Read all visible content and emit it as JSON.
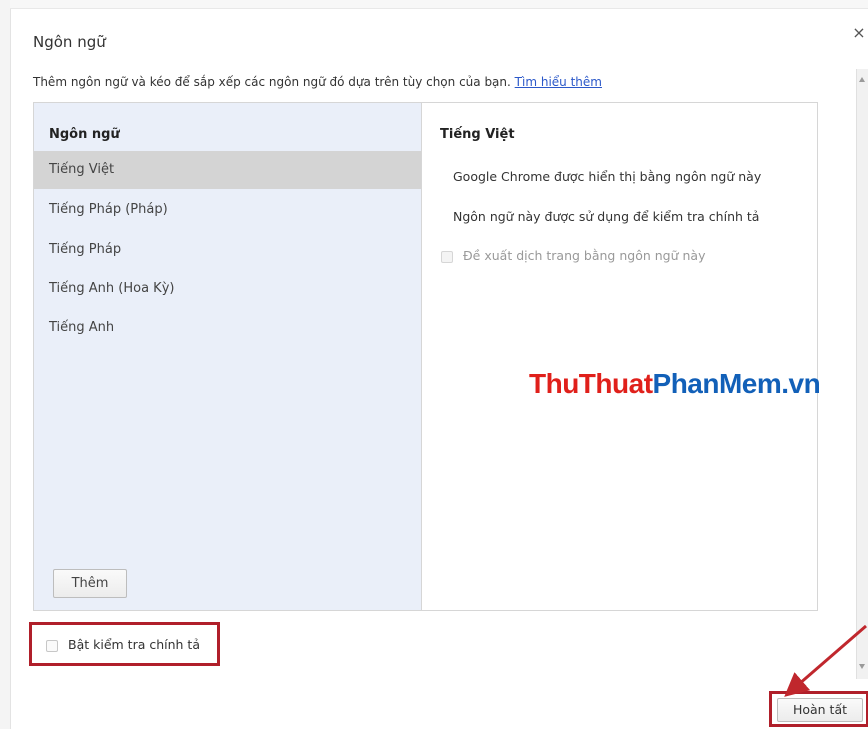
{
  "dialog": {
    "title": "Ngôn ngữ",
    "close_glyph": "×",
    "intro_text": "Thêm ngôn ngữ và kéo để sắp xếp các ngôn ngữ đó dựa trên tùy chọn của bạn.",
    "learn_more_link": "Tìm hiểu thêm"
  },
  "languages": {
    "header": "Ngôn ngữ",
    "items": [
      {
        "label": "Tiếng Việt",
        "selected": true
      },
      {
        "label": "Tiếng Pháp (Pháp)",
        "selected": false
      },
      {
        "label": "Tiếng Pháp",
        "selected": false
      },
      {
        "label": "Tiếng Anh (Hoa Kỳ)",
        "selected": false
      },
      {
        "label": "Tiếng Anh",
        "selected": false
      }
    ],
    "add_button": "Thêm"
  },
  "detail": {
    "title": "Tiếng Việt",
    "line1": "Google Chrome được hiển thị bằng ngôn ngữ này",
    "line2": "Ngôn ngữ này được sử dụng để kiểm tra chính tả",
    "translate_checkbox": {
      "label": "Đề xuất dịch trang bằng ngôn ngữ này",
      "checked": false,
      "disabled": true
    }
  },
  "spellcheck": {
    "label": "Bật kiểm tra chính tả",
    "checked": false
  },
  "done_button": "Hoàn tất",
  "watermark": {
    "part1": "ThuThuat",
    "part2": "PhanMem",
    "part3": ".vn"
  },
  "colors": {
    "highlight_border": "#b01f2a",
    "link": "#2b58c9",
    "list_bg": "#eaeff9",
    "selected_bg": "#d4d4d4",
    "watermark_red": "#e0201b",
    "watermark_blue": "#1260b8"
  }
}
